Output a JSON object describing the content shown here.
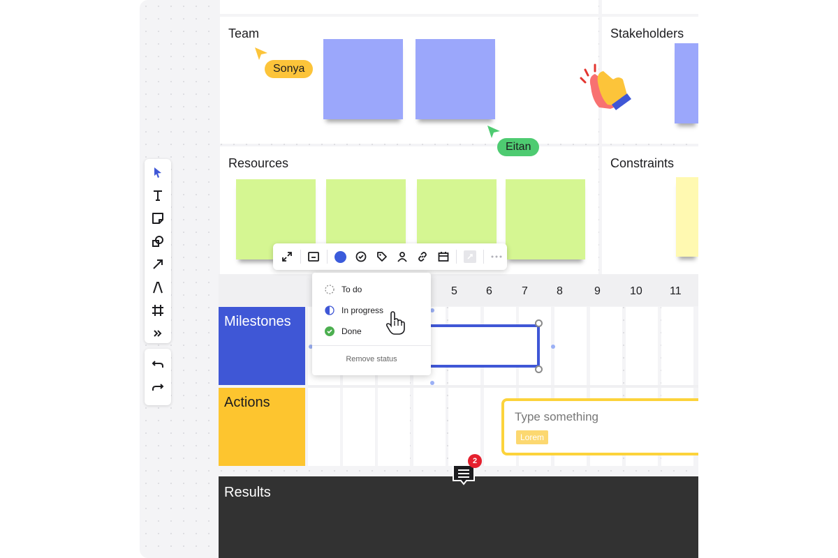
{
  "frames": {
    "team": "Team",
    "stakeholders": "Stakeholders",
    "resources": "Resources",
    "constraints": "Constraints"
  },
  "cursors": {
    "sonya": "Sonya",
    "eitan": "Eitan"
  },
  "toolbar": {
    "tools": [
      "select-icon",
      "text-icon",
      "sticky-note-icon",
      "shapes-icon",
      "arrow-icon",
      "pen-icon",
      "frame-icon",
      "more-tools-icon"
    ],
    "undo": "undo-icon",
    "redo": "redo-icon"
  },
  "context_toolbar": {
    "items": [
      "expand-icon",
      "card-icon",
      "color-swatch",
      "status-icon",
      "tag-icon",
      "assignee-icon",
      "link-icon",
      "calendar-icon",
      "disabled-icon",
      "more-icon"
    ],
    "color": "#3b5bdb"
  },
  "status_menu": {
    "todo": "To do",
    "in_progress": "In progress",
    "done": "Done",
    "remove": "Remove status"
  },
  "timeline": {
    "numbers": [
      "5",
      "6",
      "7",
      "8",
      "9",
      "10",
      "11"
    ]
  },
  "rows": {
    "milestones": "Milestones",
    "actions": "Actions",
    "results": "Results"
  },
  "card": {
    "placeholder": "Type something",
    "tag": "Lorem"
  },
  "comments": {
    "count": "2"
  },
  "colors": {
    "milestones": "#3f57d6",
    "actions": "#fdc52f",
    "results": "#323232",
    "sticky_blue": "#9ba7fb",
    "sticky_green": "#d5f692",
    "sticky_yellow": "#fff9b1",
    "sonya": "#fcc43a",
    "eitan": "#4ecb71"
  }
}
